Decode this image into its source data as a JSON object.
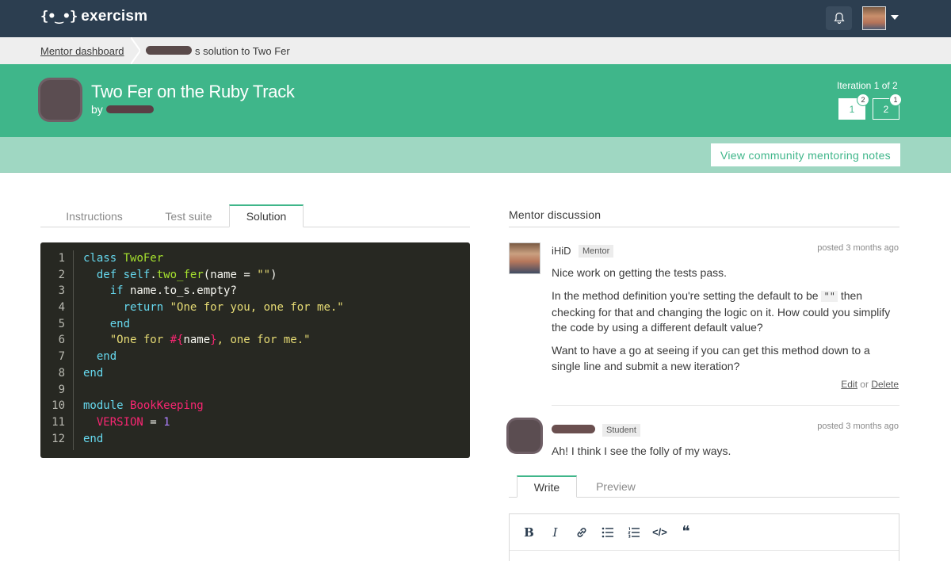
{
  "nav": {
    "logo_mark": "{•‿•}",
    "logo_text": "exercism",
    "bell_icon": "bell-icon",
    "caret_icon": "chevron-down-icon"
  },
  "breadcrumb": {
    "items": [
      {
        "label": "Mentor dashboard"
      },
      {
        "label": "s solution to Two Fer"
      }
    ]
  },
  "header": {
    "title": "Two Fer on the Ruby Track",
    "by_label": "by",
    "iteration_label": "Iteration 1 of 2",
    "iterations": [
      {
        "number": "1",
        "count": "2",
        "active": true
      },
      {
        "number": "2",
        "count": "1",
        "active": false
      }
    ]
  },
  "subheader": {
    "notes_button": "View community mentoring notes"
  },
  "tabs": [
    {
      "label": "Instructions"
    },
    {
      "label": "Test suite"
    },
    {
      "label": "Solution",
      "active": true
    }
  ],
  "code": {
    "language": "ruby",
    "line_numbers": [
      "1",
      "2",
      "3",
      "4",
      "5",
      "6",
      "7",
      "8",
      "9",
      "10",
      "11",
      "12"
    ],
    "lines": [
      "class TwoFer",
      "  def self.two_fer(name = \"\")",
      "    if name.to_s.empty?",
      "      return \"One for you, one for me.\"",
      "    end",
      "    \"One for #{name}, one for me.\"",
      "  end",
      "end",
      "",
      "module BookKeeping",
      "  VERSION = 1",
      "end"
    ]
  },
  "discussion": {
    "title": "Mentor discussion",
    "posts": [
      {
        "author": "iHiD",
        "role": "Mentor",
        "posted": "posted 3 months ago",
        "paragraphs": [
          "Nice work on getting the tests pass.",
          "In the method definition you're setting the default to be",
          "\"\"",
          "then checking for that and changing the logic on it. How could you simplify the code by using a different default value?",
          "Want to have a go at seeing if you can get this method down to a single line and submit a new iteration?"
        ],
        "edit_label": "Edit",
        "or_label": "or",
        "delete_label": "Delete"
      },
      {
        "author": "",
        "role": "Student",
        "posted": "posted 3 months ago",
        "paragraphs": [
          "Ah! I think I see the folly of my ways."
        ]
      }
    ]
  },
  "editor": {
    "tabs": [
      {
        "label": "Write",
        "active": true
      },
      {
        "label": "Preview"
      }
    ],
    "toolbar": [
      {
        "icon": "bold-icon",
        "glyph": "B"
      },
      {
        "icon": "italic-icon",
        "glyph": "I"
      },
      {
        "icon": "link-icon",
        "glyph": ""
      },
      {
        "icon": "bulleted-list-icon",
        "glyph": ""
      },
      {
        "icon": "numbered-list-icon",
        "glyph": ""
      },
      {
        "icon": "code-icon",
        "glyph": "</>"
      },
      {
        "icon": "quote-icon",
        "glyph": "❝"
      }
    ]
  },
  "colors": {
    "nav_bg": "#2c3e50",
    "accent": "#3fb68a",
    "subheader_bg": "#9fd7c2",
    "code_bg": "#272822"
  }
}
